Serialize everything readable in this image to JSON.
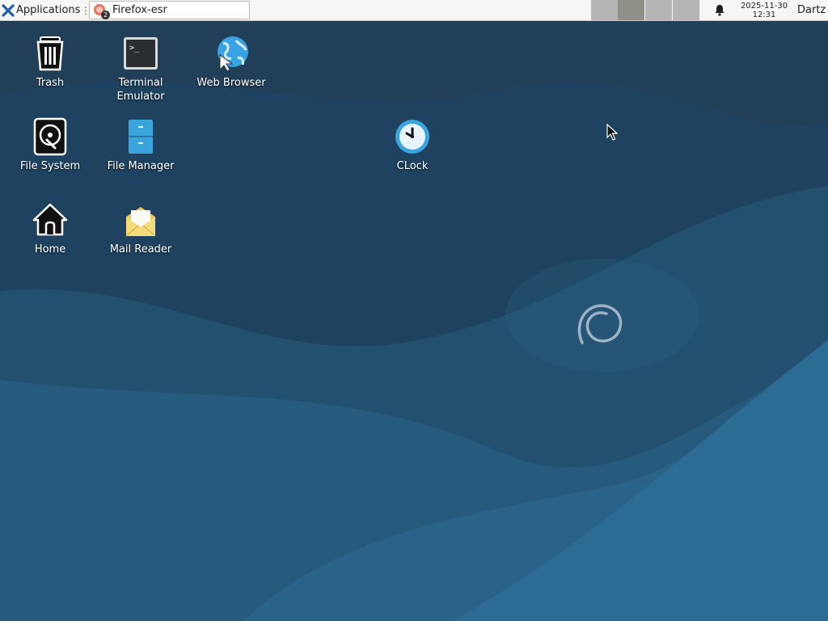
{
  "panel": {
    "applications_label": "Applications",
    "separator": "⋮",
    "task_window_title": "Firefox-esr",
    "task_badge_count": "2",
    "workspaces": [
      {
        "color": "#b5b5b5"
      },
      {
        "color": "#8f9088"
      },
      {
        "color": "#b5b5b5"
      },
      {
        "color": "#b5b5b5"
      }
    ],
    "clock_date": "2025-11-30",
    "clock_time": "12:31",
    "user": "Dartz"
  },
  "desktop": {
    "icons": [
      {
        "label": "Trash"
      },
      {
        "label": "Terminal Emulator"
      },
      {
        "label": "Web Browser"
      },
      {
        "label": "File System"
      },
      {
        "label": "File Manager"
      },
      {
        "label": "CLock"
      },
      {
        "label": "Home"
      },
      {
        "label": "Mail Reader"
      }
    ]
  },
  "colors": {
    "wallpaper_dark": "#1c3f5c",
    "wallpaper_mid": "#255677",
    "wallpaper_light": "#2b6a91",
    "panel_bg": "#f6f6f5"
  }
}
